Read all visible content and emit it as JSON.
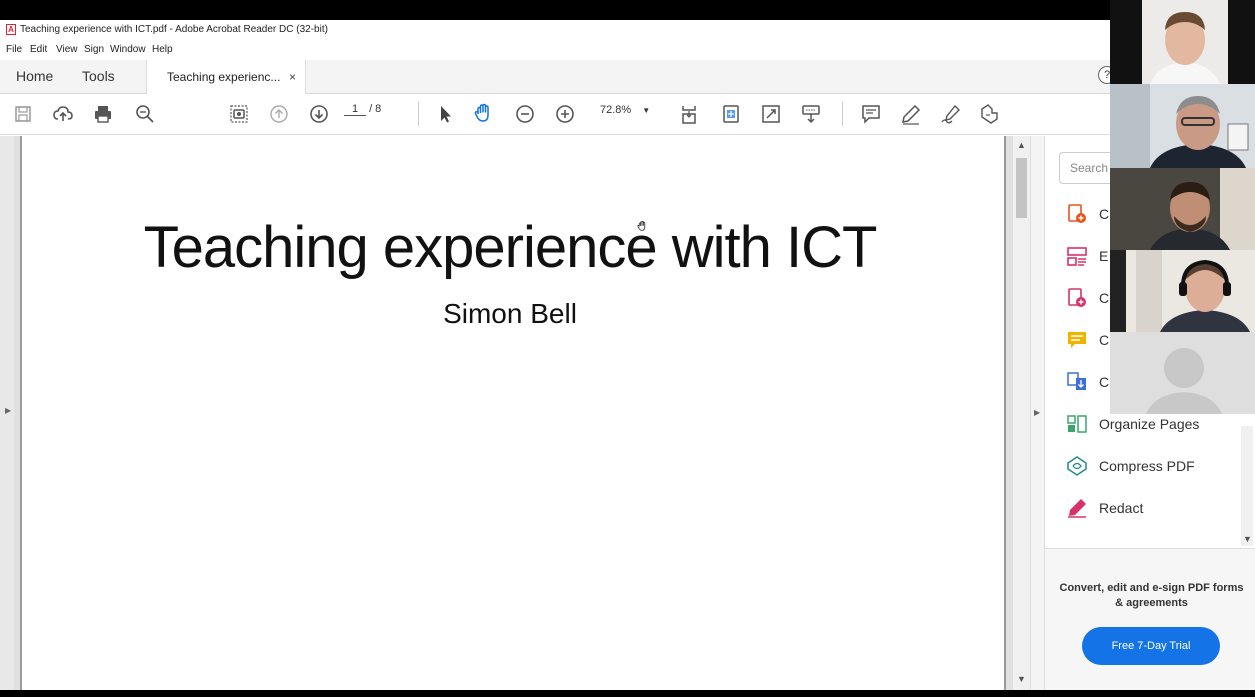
{
  "window": {
    "title": "Teaching experience with ICT.pdf - Adobe Acrobat Reader DC (32-bit)"
  },
  "menu": [
    "File",
    "Edit",
    "View",
    "Sign",
    "Window",
    "Help"
  ],
  "tabs": {
    "home": "Home",
    "tools": "Tools",
    "document": "Teaching experienc...",
    "close": "×"
  },
  "help_label": "?",
  "toolbar": {
    "page_current": "1",
    "page_total": "/ 8",
    "zoom": "72.8%"
  },
  "document": {
    "title": "Teaching experience with ICT",
    "author": "Simon Bell"
  },
  "right_panel": {
    "search_placeholder": "Search",
    "tools": [
      {
        "label": "C",
        "icon": "create-pdf-icon",
        "color": "#e8541a"
      },
      {
        "label": "E",
        "icon": "edit-pdf-icon",
        "color": "#d8306b"
      },
      {
        "label": "C",
        "icon": "combine-files-icon",
        "color": "#d8306b"
      },
      {
        "label": "C",
        "icon": "comment-icon",
        "color": "#f0b400"
      },
      {
        "label": "C",
        "icon": "export-pdf-icon",
        "color": "#3d6fd6"
      },
      {
        "label": "Organize Pages",
        "icon": "organize-pages-icon",
        "color": "#3aa56b"
      },
      {
        "label": "Compress PDF",
        "icon": "compress-pdf-icon",
        "color": "#1f8c89"
      },
      {
        "label": "Redact",
        "icon": "redact-icon",
        "color": "#d8306b"
      }
    ],
    "promo_text": "Convert, edit and e-sign PDF forms & agreements",
    "promo_button": "Free 7-Day Trial"
  },
  "colors": {
    "accent": "#1473e6"
  }
}
